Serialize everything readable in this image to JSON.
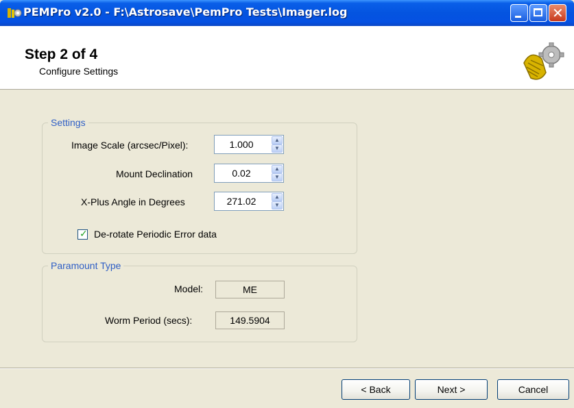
{
  "window": {
    "title": "PEMPro v2.0 - F:\\Astrosave\\PemPro Tests\\Imager.log",
    "close_glyph": "✕"
  },
  "header": {
    "step_title": "Step 2 of 4",
    "step_subtitle": "Configure Settings"
  },
  "settings": {
    "legend": "Settings",
    "image_scale": {
      "label": "Image Scale (arcsec/Pixel):",
      "value": "1.000"
    },
    "mount_declination": {
      "label": "Mount Declination",
      "value": "0.02"
    },
    "xplus_angle": {
      "label": "X-Plus Angle in Degrees",
      "value": "271.02"
    },
    "derotate": {
      "label": "De-rotate Periodic Error data",
      "checked": true
    }
  },
  "paramount": {
    "legend": "Paramount Type",
    "model": {
      "label": "Model:",
      "value": "ME"
    },
    "worm_period": {
      "label": "Worm Period (secs):",
      "value": "149.5904"
    }
  },
  "footer": {
    "back_label": "< Back",
    "next_label": "Next >",
    "cancel_label": "Cancel"
  },
  "colors": {
    "titlebar": "#0454e0",
    "legend": "#2e5ec5",
    "dialog_bg": "#ece9d8"
  }
}
